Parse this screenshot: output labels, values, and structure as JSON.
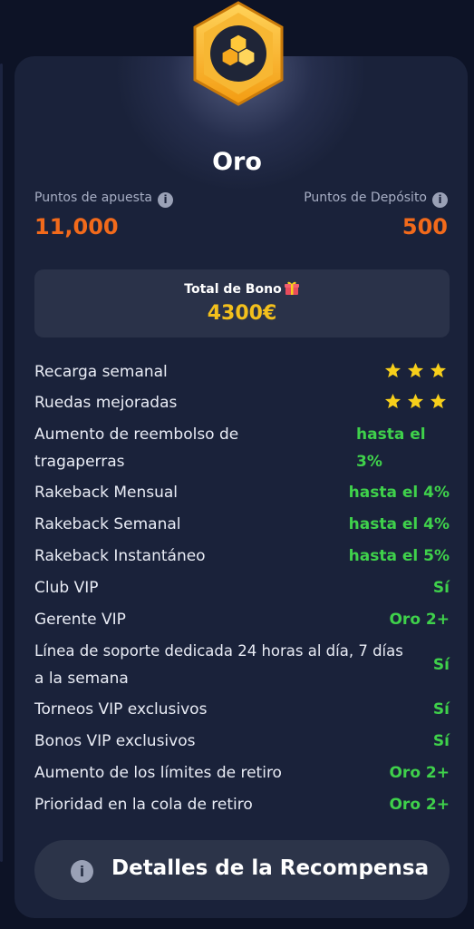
{
  "tier": {
    "name": "Oro",
    "bet_points_label": "Puntos de apuesta",
    "bet_points_value": "11,000",
    "deposit_points_label": "Puntos de Depósito",
    "deposit_points_value": "500"
  },
  "bonus": {
    "title": "Total de Bono",
    "value": "4300€"
  },
  "benefits": [
    {
      "label": "Recarga semanal",
      "stars": 3
    },
    {
      "label": "Ruedas mejoradas",
      "stars": 3
    },
    {
      "label_line1": "Aumento de reembolso de",
      "label_line2": "tragaperras",
      "value_line1": "hasta el",
      "value_line2": "3%"
    },
    {
      "label": "Rakeback Mensual",
      "value": "hasta el 4%"
    },
    {
      "label": "Rakeback Semanal",
      "value": "hasta el 4%"
    },
    {
      "label": "Rakeback Instantáneo",
      "value": "hasta el 5%"
    },
    {
      "label": "Club VIP",
      "value": "Sí"
    },
    {
      "label": "Gerente VIP",
      "value": "Oro 2+"
    },
    {
      "label_line1": "Línea de soporte dedicada 24 horas al día, 7 días",
      "label_line2": "a la semana",
      "value": "Sí"
    },
    {
      "label": "Torneos VIP exclusivos",
      "value": "Sí"
    },
    {
      "label": "Bonos VIP exclusivos",
      "value": "Sí"
    },
    {
      "label": "Aumento de los límites de retiro",
      "value": "Oro 2+"
    },
    {
      "label": "Prioridad en la cola de retiro",
      "value": "Oro 2+"
    }
  ],
  "cta": {
    "label": "Detalles de la Recompensa"
  },
  "icons": {
    "tier_badge": "gold-hexagon-cubes-icon",
    "info": "info-icon",
    "gift": "gift-icon",
    "star": "star-icon"
  },
  "colors": {
    "points": "#f26a1b",
    "bonus": "#f3c01c",
    "benefit_value": "#3fd14b",
    "star": "#f7cf1b"
  }
}
